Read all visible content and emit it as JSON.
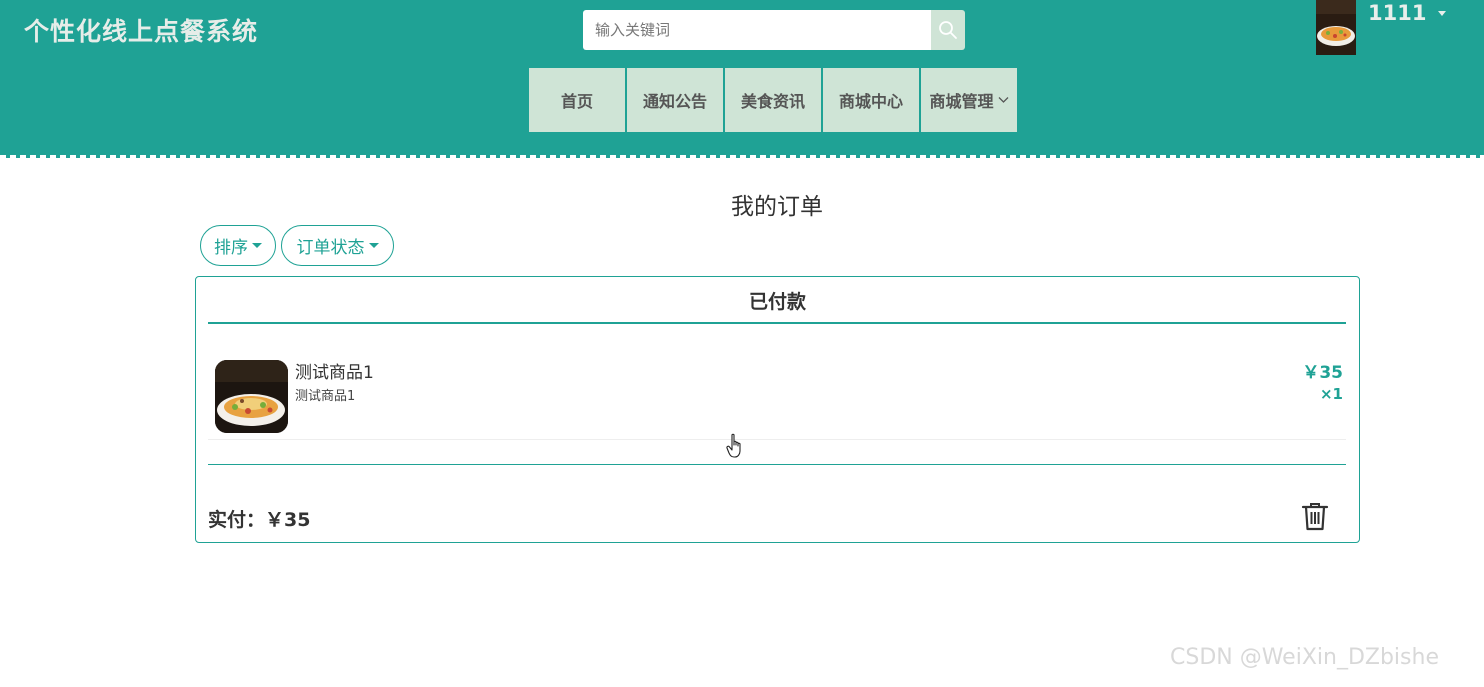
{
  "header": {
    "site_title": "个性化线上点餐系统",
    "search": {
      "placeholder": "输入关键词",
      "value": ""
    },
    "search_icon": "search-icon",
    "user": {
      "name": "1111",
      "avatar_icon": "food-avatar"
    },
    "nav": [
      {
        "label": "首页"
      },
      {
        "label": "通知公告"
      },
      {
        "label": "美食资讯"
      },
      {
        "label": "商城中心"
      },
      {
        "label": "商城管理",
        "icon": "chevron-down-icon"
      }
    ]
  },
  "main": {
    "page_title": "我的订单",
    "filters": {
      "sort_label": "排序",
      "status_label": "订单状态"
    },
    "order": {
      "status": "已付款",
      "items": [
        {
          "name": "测试商品1",
          "desc": "测试商品1",
          "price": "￥35",
          "qty": "×1"
        }
      ],
      "paid_label": "实付：￥35",
      "delete_icon": "trash-icon"
    }
  },
  "watermark": "CSDN @WeiXin_DZbishe",
  "colors": {
    "primary": "#1fa295",
    "nav_bg": "#cfe4d6",
    "title_text": "#e6ede9"
  }
}
